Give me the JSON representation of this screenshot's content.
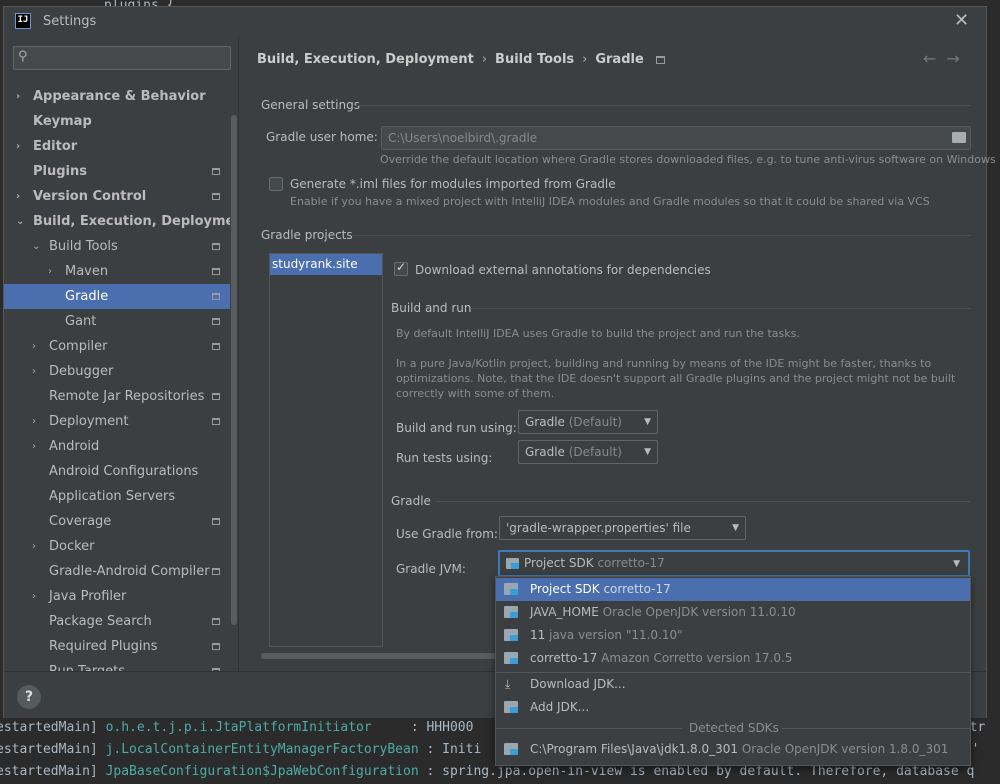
{
  "window": {
    "title": "Settings",
    "app_icon": "IJ"
  },
  "background": {
    "code_top": "plugins {",
    "console": [
      {
        "prefix": "estartedMain]",
        "cls": "o.h.e.t.j.p.i.JtaPlatformInitiator",
        "msg": "     : HHH000",
        "tail": "e.tr"
      },
      {
        "prefix": "estartedMain]",
        "cls": "j.LocalContainerEntityManagerFactoryBean",
        "msg": " : Initi",
        "tail": "lt'"
      },
      {
        "prefix": "estartedMain]",
        "cls": "JpaBaseConfiguration$JpaWebConfiguration",
        "msg": " : spring.jpa.open-in-view is enabled by default. Therefore, database q",
        "tail": ""
      }
    ]
  },
  "search": {
    "placeholder": ""
  },
  "sidebar": {
    "items": [
      {
        "label": "Appearance & Behavior",
        "bold": true,
        "arrow": "›",
        "indent": 0,
        "proj": false
      },
      {
        "label": "Keymap",
        "bold": true,
        "arrow": "",
        "indent": 0,
        "proj": false
      },
      {
        "label": "Editor",
        "bold": true,
        "arrow": "›",
        "indent": 0,
        "proj": false
      },
      {
        "label": "Plugins",
        "bold": true,
        "arrow": "",
        "indent": 0,
        "proj": true
      },
      {
        "label": "Version Control",
        "bold": true,
        "arrow": "›",
        "indent": 0,
        "proj": true
      },
      {
        "label": "Build, Execution, Deployment",
        "bold": true,
        "arrow": "⌄",
        "indent": 0,
        "proj": false
      },
      {
        "label": "Build Tools",
        "bold": false,
        "arrow": "⌄",
        "indent": 1,
        "proj": true
      },
      {
        "label": "Maven",
        "bold": false,
        "arrow": "›",
        "indent": 2,
        "proj": true
      },
      {
        "label": "Gradle",
        "bold": false,
        "arrow": "",
        "indent": 2,
        "proj": true,
        "selected": true
      },
      {
        "label": "Gant",
        "bold": false,
        "arrow": "",
        "indent": 2,
        "proj": true
      },
      {
        "label": "Compiler",
        "bold": false,
        "arrow": "›",
        "indent": 1,
        "proj": true
      },
      {
        "label": "Debugger",
        "bold": false,
        "arrow": "›",
        "indent": 1,
        "proj": false
      },
      {
        "label": "Remote Jar Repositories",
        "bold": false,
        "arrow": "",
        "indent": 1,
        "proj": true
      },
      {
        "label": "Deployment",
        "bold": false,
        "arrow": "›",
        "indent": 1,
        "proj": true
      },
      {
        "label": "Android",
        "bold": false,
        "arrow": "›",
        "indent": 1,
        "proj": false
      },
      {
        "label": "Android Configurations",
        "bold": false,
        "arrow": "",
        "indent": 1,
        "proj": false
      },
      {
        "label": "Application Servers",
        "bold": false,
        "arrow": "",
        "indent": 1,
        "proj": false
      },
      {
        "label": "Coverage",
        "bold": false,
        "arrow": "",
        "indent": 1,
        "proj": true
      },
      {
        "label": "Docker",
        "bold": false,
        "arrow": "›",
        "indent": 1,
        "proj": false
      },
      {
        "label": "Gradle-Android Compiler",
        "bold": false,
        "arrow": "",
        "indent": 1,
        "proj": true
      },
      {
        "label": "Java Profiler",
        "bold": false,
        "arrow": "›",
        "indent": 1,
        "proj": false
      },
      {
        "label": "Package Search",
        "bold": false,
        "arrow": "",
        "indent": 1,
        "proj": true
      },
      {
        "label": "Required Plugins",
        "bold": false,
        "arrow": "",
        "indent": 1,
        "proj": true
      },
      {
        "label": "Run Targets",
        "bold": false,
        "arrow": "",
        "indent": 1,
        "proj": true
      }
    ]
  },
  "breadcrumb": [
    "Build, Execution, Deployment",
    "Build Tools",
    "Gradle"
  ],
  "nav": {
    "back": "←",
    "forward": "→"
  },
  "general": {
    "header": "General settings",
    "user_home_label": "Gradle user home:",
    "user_home_value": "C:\\Users\\noelbird\\.gradle",
    "user_home_hint": "Override the default location where Gradle stores downloaded files, e.g. to tune anti-virus software on Windows",
    "iml_label": "Generate *.iml files for modules imported from Gradle",
    "iml_checked": false,
    "iml_hint": "Enable if you have a mixed project with IntelliJ IDEA modules and Gradle modules so that it could be shared via VCS"
  },
  "projects": {
    "header": "Gradle projects",
    "list": [
      "studyrank.site"
    ],
    "download_annotations_label": "Download external annotations for dependencies",
    "download_annotations_checked": true
  },
  "build_run": {
    "header": "Build and run",
    "desc1": "By default IntelliJ IDEA uses Gradle to build the project and run the tasks.",
    "desc2a": "In a pure Java/Kotlin project, building and running by means of the IDE might be faster, thanks to",
    "desc2b": "optimizations. Note, that the IDE doesn't support all Gradle plugins and the project might not be built",
    "desc2c": "correctly with some of them.",
    "build_label": "Build and run using:",
    "build_value": "Gradle",
    "build_suffix": "(Default)",
    "tests_label": "Run tests using:",
    "tests_value": "Gradle",
    "tests_suffix": "(Default)"
  },
  "gradle": {
    "header": "Gradle",
    "use_from_label": "Use Gradle from:",
    "use_from_value": "'gradle-wrapper.properties' file",
    "jvm_label": "Gradle JVM:",
    "jvm_value": "Project SDK",
    "jvm_suffix": "corretto-17"
  },
  "popup": {
    "items": [
      {
        "name": "Project SDK",
        "detail": "corretto-17",
        "selected": true
      },
      {
        "name": "JAVA_HOME",
        "detail": "Oracle OpenJDK version 11.0.10"
      },
      {
        "name": "11",
        "detail": "java version \"11.0.10\""
      },
      {
        "name": "corretto-17",
        "detail": "Amazon Corretto version 17.0.5"
      }
    ],
    "download": "Download JDK...",
    "add": "Add JDK...",
    "detected_header": "Detected SDKs",
    "detected": {
      "name": "C:\\Program Files\\Java\\jdk1.8.0_301",
      "detail": "Oracle OpenJDK version 1.8.0_301"
    }
  },
  "footer": {
    "help": "?"
  }
}
